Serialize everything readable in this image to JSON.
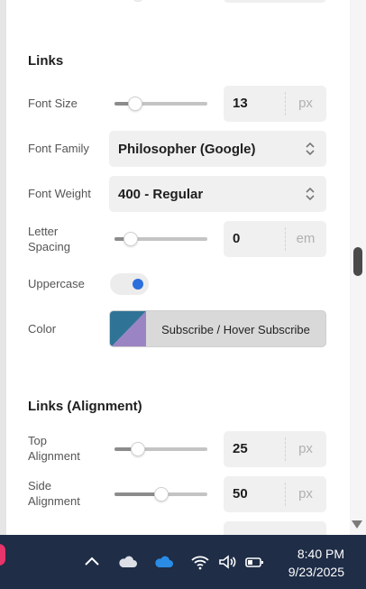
{
  "sections": {
    "links_title": "Links",
    "links_alignment_title": "Links (Alignment)"
  },
  "font_size": {
    "label": "Font Size",
    "value": "13",
    "unit": "px",
    "slider_fraction": 0.22
  },
  "font_family": {
    "label": "Font Family",
    "value": "Philosopher (Google)"
  },
  "font_weight": {
    "label": "Font Weight",
    "value": "400 - Regular"
  },
  "letter_spacing": {
    "label": "Letter Spacing",
    "value": "0",
    "unit": "em",
    "slider_fraction": 0.17
  },
  "uppercase": {
    "label": "Uppercase",
    "enabled": true
  },
  "color": {
    "label": "Color",
    "button_text": "Subscribe / Hover Subscribe",
    "swatch_primary": "#2f7497",
    "swatch_secondary": "#9b84c3"
  },
  "top_alignment": {
    "label": "Top Alignment",
    "value": "25",
    "unit": "px",
    "slider_fraction": 0.25
  },
  "side_alignment": {
    "label": "Side Alignment",
    "value": "50",
    "unit": "px",
    "slider_fraction": 0.5
  },
  "taskbar": {
    "time": "8:40 PM",
    "date": "9/23/2025",
    "icons": [
      "chevron-up-icon",
      "cloud-icon",
      "onedrive-icon",
      "wifi-icon",
      "volume-icon",
      "battery-icon"
    ],
    "accent": "#1f2d47"
  }
}
